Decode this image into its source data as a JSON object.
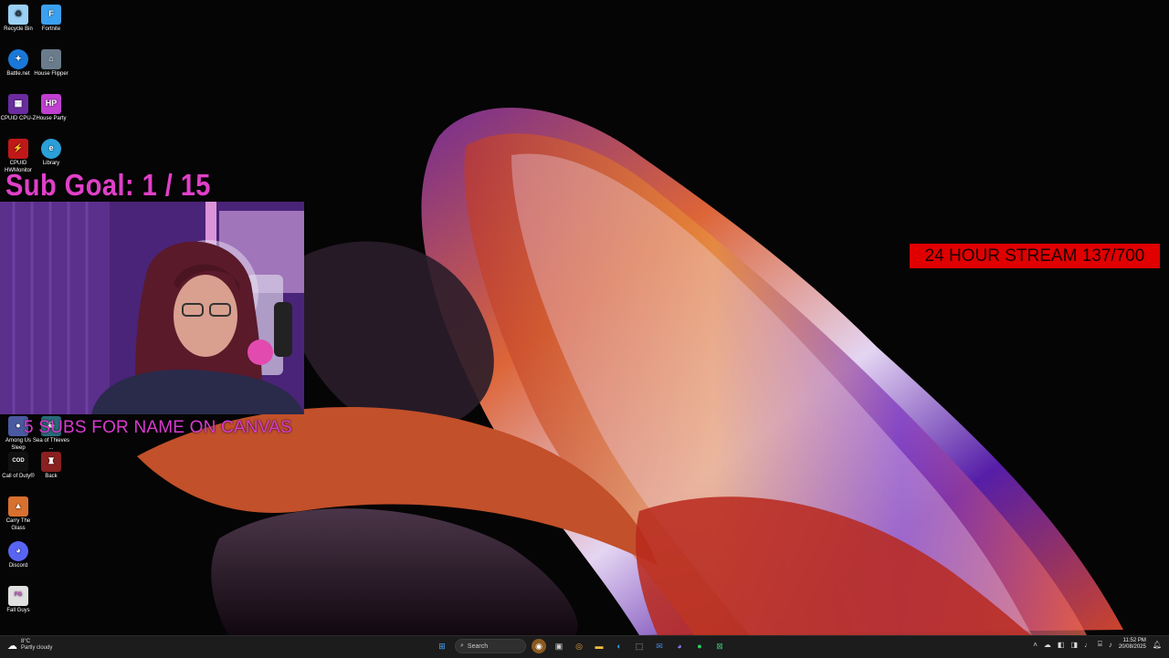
{
  "desktop_icons": [
    {
      "label": "Recycle Bin",
      "icon": "recycle-bin-icon",
      "color": "#9ad0f5"
    },
    {
      "label": "Fortnite",
      "icon": "fortnite-icon",
      "color": "#3aa0f0"
    },
    {
      "label": "Battle.net",
      "icon": "battlenet-icon",
      "color": "#1a78d8"
    },
    {
      "label": "House Flipper",
      "icon": "house-flipper-icon",
      "color": "#6a7c8c"
    },
    {
      "label": "CPUID CPU-Z",
      "icon": "cpuz-icon",
      "color": "#6a2ca0"
    },
    {
      "label": "House Party",
      "icon": "house-party-icon",
      "color": "#c040d0"
    },
    {
      "label": "CPUID HWMonitor",
      "icon": "hwmonitor-icon",
      "color": "#c01818"
    },
    {
      "label": "Library",
      "icon": "edge-icon",
      "color": "#2a9fd8"
    },
    {
      "label": "Among Us Sleep",
      "icon": "among-us-icon",
      "color": "#4a5aa0"
    },
    {
      "label": "Sea of Thieves ...",
      "icon": "sea-of-thieves-icon",
      "color": "#2a6a7a"
    },
    {
      "label": "Call of Duty®",
      "icon": "call-of-duty-icon",
      "color": "#111111"
    },
    {
      "label": "Back",
      "icon": "back-icon",
      "color": "#8a2020"
    },
    {
      "label": "Carry The Glass",
      "icon": "carry-the-glass-icon",
      "color": "#d87030"
    },
    {
      "label": "Discord",
      "icon": "discord-icon",
      "color": "#5865f2"
    },
    {
      "label": "Fall Guys",
      "icon": "fall-guys-icon",
      "color": "#e0e0e0"
    }
  ],
  "overlay": {
    "sub_goal": "Sub Goal:  1 / 15",
    "subs_canvas": "5 SUBS FOR NAME ON CANVAS",
    "stream_banner": "24 HOUR STREAM 137/700",
    "banner_color": "#e00000",
    "accent_color": "#e040c8"
  },
  "taskbar": {
    "weather_temp": "8°C",
    "weather_desc": "Partly cloudy",
    "search_placeholder": "Search",
    "time": "11:52 PM",
    "date": "20/08/2025"
  }
}
